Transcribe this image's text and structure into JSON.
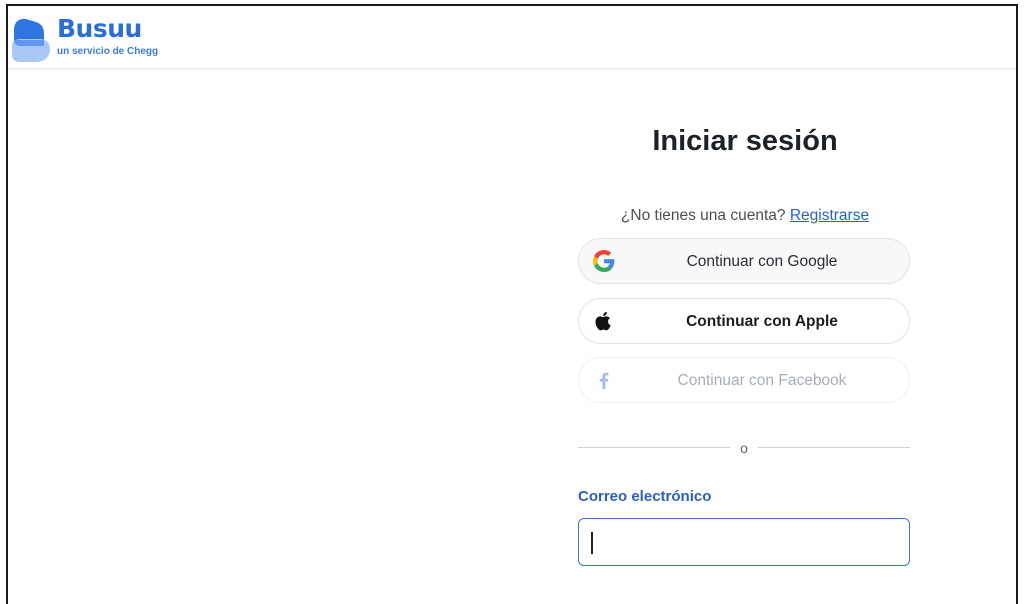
{
  "brand": {
    "name": "Busuu",
    "tagline": "un servicio de Chegg",
    "primary_color": "#2b6fd6",
    "mark_colors": [
      "#2f76e3",
      "#a9c8f7"
    ]
  },
  "login": {
    "title": "Iniciar sesión",
    "no_account_text": "¿No tienes una cuenta?",
    "register_link": "Registrarse",
    "buttons": {
      "google": {
        "label": "Continuar con Google",
        "icon": "google-icon"
      },
      "apple": {
        "label": "Continuar con Apple",
        "icon": "apple-icon"
      },
      "facebook": {
        "label": "Continuar con Facebook",
        "icon": "facebook-icon",
        "state": "disabled"
      }
    },
    "divider_text": "o",
    "email": {
      "label": "Correo electrónico",
      "value": "",
      "placeholder": ""
    }
  }
}
